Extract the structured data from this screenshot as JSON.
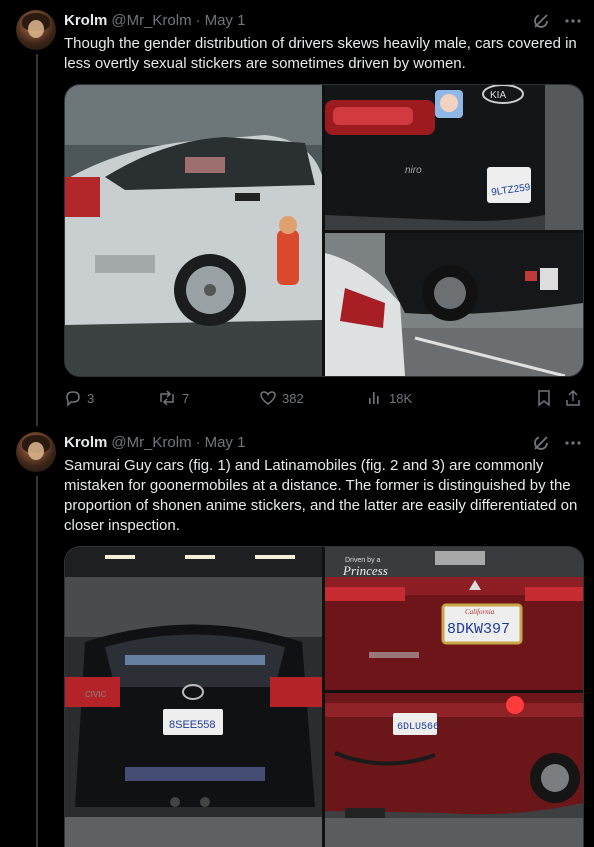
{
  "tweets": [
    {
      "name": "Krolm",
      "handle": "@Mr_Krolm",
      "separator": "·",
      "date": "May 1",
      "text": "Though the gender distribution of drivers skews heavily male, cars covered in less overtly sexual stickers are sometimes driven by women.",
      "media": {
        "plate_1": "9LTZ259",
        "badge_1": "KIA",
        "model_1": "niro"
      },
      "actions": {
        "replies": "3",
        "reposts": "7",
        "likes": "382",
        "views": "18K"
      }
    },
    {
      "name": "Krolm",
      "handle": "@Mr_Krolm",
      "separator": "·",
      "date": "May 1",
      "text": "Samurai Guy cars (fig. 1) and Latinamobiles (fig. 2 and 3) are commonly mistaken for goonermobiles at a distance. The former is distinguished by the proportion of shonen anime stickers, and the latter are easily differentiated on closer inspection.",
      "media": {
        "plate_1": "8SEE558",
        "plate_2": "8DKW397",
        "plate_3": "6DLU566",
        "sticker_script": "Princess",
        "sticker_small": "Driven by a",
        "frame_state": "California",
        "model_2": "CIVIC"
      }
    }
  ],
  "icons": {
    "grok": "grok-icon",
    "more": "more-icon",
    "reply": "reply-icon",
    "repost": "repost-icon",
    "like": "like-icon",
    "views": "views-icon",
    "bookmark": "bookmark-icon",
    "share": "share-icon"
  },
  "colors": {
    "background": "#000000",
    "text": "#e7e9ea",
    "muted": "#71767b",
    "divider": "#2f3336"
  }
}
